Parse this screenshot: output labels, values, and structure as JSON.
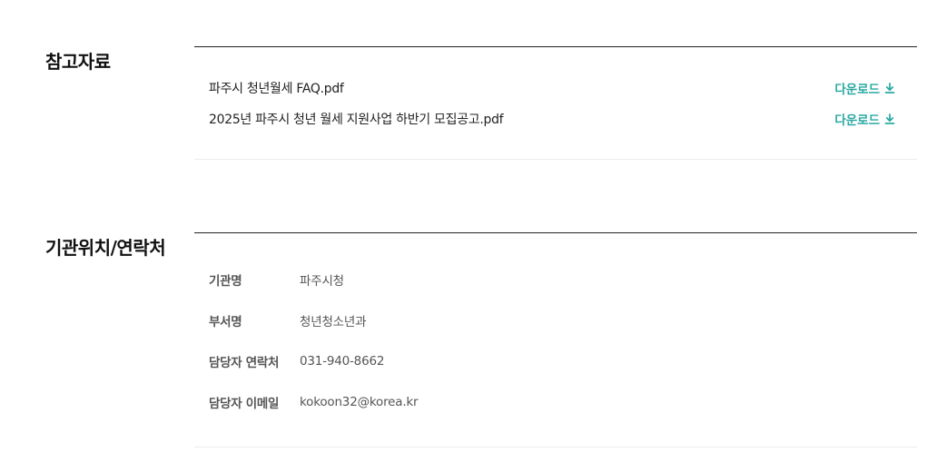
{
  "references": {
    "title": "참고자료",
    "files": [
      {
        "name": "파주시 청년월세 FAQ.pdf",
        "download_label": "다운로드"
      },
      {
        "name": "2025년 파주시 청년 월세 지원사업 하반기 모집공고.pdf",
        "download_label": "다운로드"
      }
    ],
    "download_icon": "download-icon"
  },
  "contact": {
    "title": "기관위치/연락처",
    "rows": [
      {
        "label": "기관명",
        "value": "파주시청"
      },
      {
        "label": "부서명",
        "value": "청년청소년과"
      },
      {
        "label": "담당자 연락처",
        "value": "031-940-8662"
      },
      {
        "label": "담당자 이메일",
        "value": "kokoon32@korea.kr"
      }
    ]
  },
  "colors": {
    "accent": "#2aa9a4",
    "divider_dark": "#222222",
    "divider_light": "#ececec"
  }
}
